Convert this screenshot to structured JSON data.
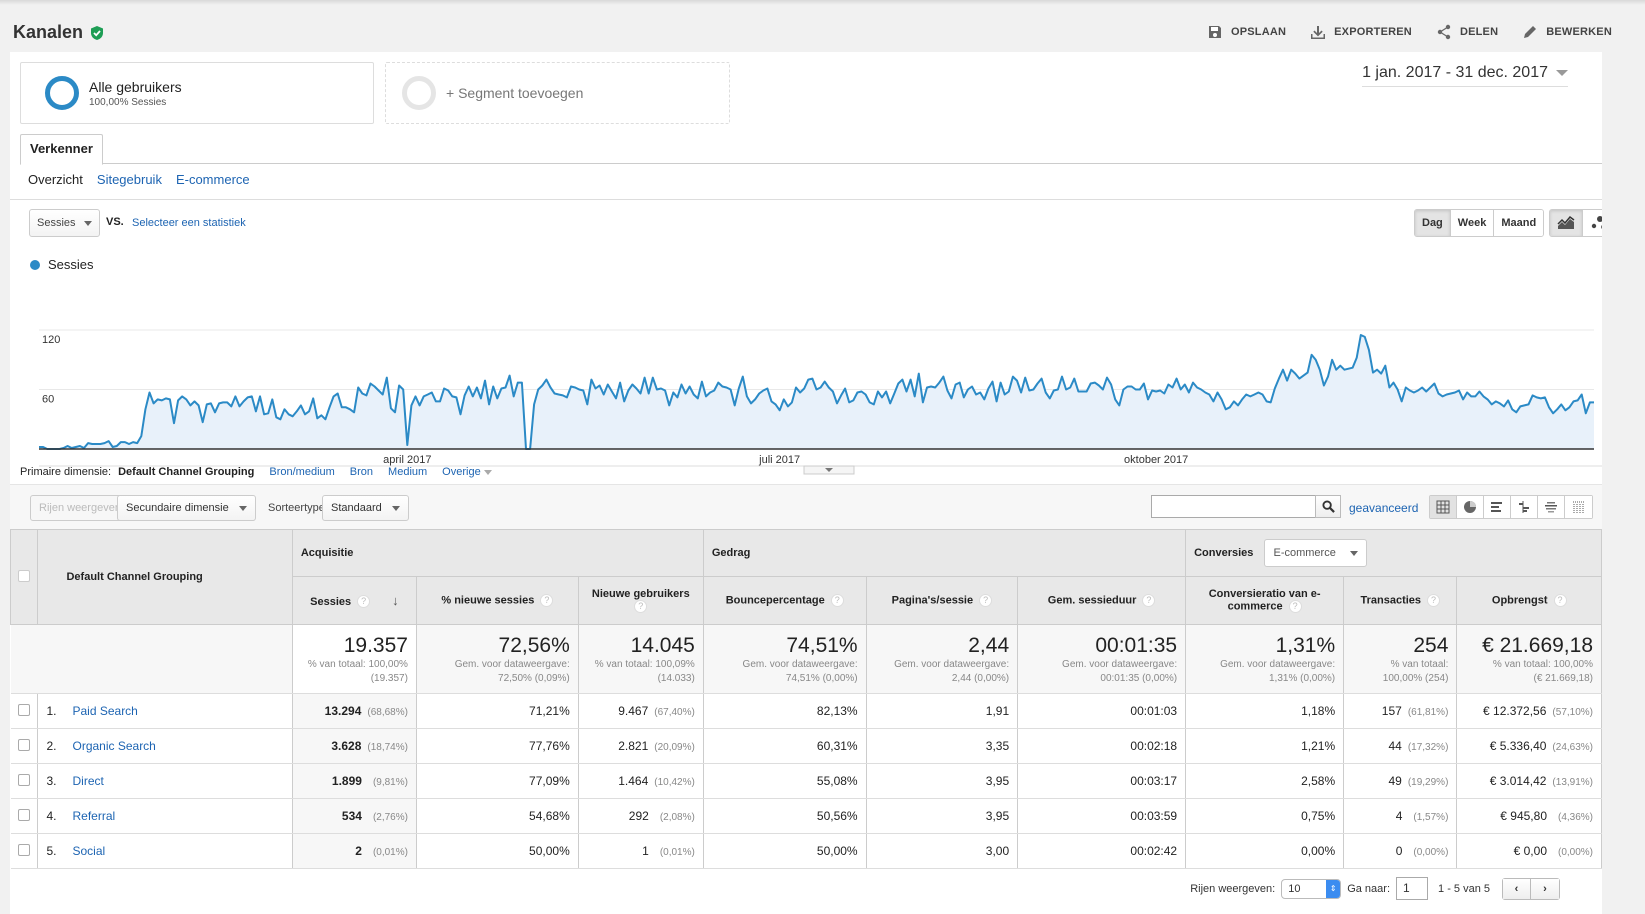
{
  "header": {
    "title": "Kanalen",
    "verified_icon": "shield-check-icon",
    "actions": [
      {
        "label": "OPSLAAN",
        "icon": "save-icon"
      },
      {
        "label": "EXPORTEREN",
        "icon": "download-icon"
      },
      {
        "label": "DELEN",
        "icon": "share-icon"
      },
      {
        "label": "BEWERKEN",
        "icon": "pencil-icon"
      }
    ]
  },
  "segments": {
    "active": {
      "name": "Alle gebruikers",
      "sub": "100,00% Sessies"
    },
    "add_label": "+ Segment toevoegen"
  },
  "date_range": "1 jan. 2017 - 31 dec. 2017",
  "tabs": {
    "main": "Verkenner",
    "sub": [
      {
        "label": "Overzicht",
        "selected": true
      },
      {
        "label": "Sitegebruik",
        "selected": false
      },
      {
        "label": "E-commerce",
        "selected": false
      }
    ]
  },
  "chart_controls": {
    "metric": "Sessies",
    "vs_label": "VS.",
    "compare_link": "Selecteer een statistiek",
    "periods": [
      {
        "label": "Dag",
        "active": true
      },
      {
        "label": "Week",
        "active": false
      },
      {
        "label": "Maand",
        "active": false
      }
    ],
    "chart_types": [
      {
        "icon": "line-chart-icon",
        "active": true
      },
      {
        "icon": "motion-chart-icon",
        "active": false
      }
    ]
  },
  "chart_data": {
    "type": "area",
    "title": "",
    "legend": [
      "Sessies"
    ],
    "legend_position": "top-left",
    "color": "#2b8ac6",
    "fill": "#e8f1fa",
    "xlabel": "",
    "ylabel": "",
    "ylim": [
      0,
      120
    ],
    "yticks": [
      60,
      120
    ],
    "x_range": [
      "2017-01-01",
      "2017-12-31"
    ],
    "xticks": [
      {
        "label": "april 2017",
        "day": 90
      },
      {
        "label": "juli 2017",
        "day": 181
      },
      {
        "label": "oktober 2017",
        "day": 273
      }
    ],
    "grid": true,
    "series": [
      {
        "name": "Sessies",
        "values": [
          2,
          2,
          0,
          0,
          0,
          0,
          1,
          3,
          1,
          2,
          3,
          1,
          6,
          5,
          5,
          5,
          6,
          8,
          2,
          3,
          7,
          7,
          5,
          7,
          6,
          13,
          40,
          57,
          46,
          50,
          49,
          51,
          50,
          26,
          49,
          53,
          50,
          44,
          48,
          44,
          27,
          45,
          46,
          37,
          46,
          47,
          47,
          43,
          53,
          43,
          48,
          52,
          53,
          38,
          53,
          35,
          36,
          50,
          32,
          30,
          40,
          35,
          33,
          38,
          44,
          35,
          38,
          51,
          31,
          34,
          30,
          42,
          53,
          56,
          42,
          42,
          40,
          37,
          62,
          56,
          54,
          66,
          63,
          59,
          55,
          72,
          41,
          37,
          64,
          60,
          4,
          44,
          53,
          44,
          53,
          55,
          57,
          48,
          48,
          61,
          59,
          53,
          52,
          35,
          54,
          63,
          53,
          62,
          51,
          69,
          45,
          63,
          51,
          61,
          62,
          74,
          53,
          67,
          67,
          0,
          0,
          45,
          60,
          64,
          70,
          62,
          56,
          55,
          54,
          52,
          63,
          62,
          60,
          59,
          45,
          70,
          61,
          64,
          55,
          65,
          58,
          51,
          67,
          48,
          59,
          65,
          61,
          56,
          72,
          56,
          72,
          60,
          61,
          59,
          44,
          57,
          52,
          65,
          56,
          63,
          55,
          51,
          68,
          53,
          57,
          59,
          67,
          63,
          62,
          60,
          44,
          61,
          73,
          53,
          46,
          50,
          56,
          59,
          61,
          48,
          45,
          39,
          50,
          43,
          47,
          62,
          57,
          61,
          70,
          71,
          60,
          62,
          68,
          62,
          58,
          46,
          54,
          61,
          47,
          49,
          57,
          58,
          55,
          47,
          45,
          58,
          52,
          58,
          46,
          56,
          66,
          70,
          58,
          70,
          53,
          76,
          47,
          62,
          63,
          62,
          67,
          73,
          59,
          51,
          65,
          67,
          52,
          60,
          63,
          55,
          57,
          50,
          61,
          68,
          48,
          67,
          55,
          58,
          73,
          69,
          57,
          72,
          59,
          60,
          66,
          71,
          57,
          51,
          59,
          60,
          73,
          60,
          62,
          71,
          58,
          58,
          58,
          66,
          67,
          64,
          60,
          72,
          65,
          50,
          44,
          60,
          63,
          63,
          60,
          60,
          66,
          50,
          59,
          58,
          59,
          56,
          65,
          62,
          71,
          60,
          65,
          57,
          67,
          62,
          60,
          57,
          55,
          48,
          57,
          50,
          40,
          42,
          48,
          44,
          50,
          55,
          53,
          55,
          57,
          55,
          48,
          47,
          61,
          71,
          80,
          69,
          80,
          76,
          71,
          74,
          77,
          95,
          90,
          80,
          64,
          73,
          90,
          80,
          84,
          80,
          81,
          82,
          92,
          115,
          113,
          100,
          77,
          80,
          76,
          84,
          62,
          67,
          60,
          48,
          62,
          59,
          57,
          59,
          62,
          58,
          62,
          66,
          56,
          53,
          55,
          56,
          57,
          59,
          50,
          57,
          53,
          53,
          58,
          53,
          50,
          45,
          48,
          46,
          43,
          49,
          40,
          37,
          43,
          44,
          45,
          54,
          52,
          51,
          52,
          42,
          36,
          40,
          45,
          39,
          42,
          48,
          49,
          55,
          36,
          47,
          47
        ]
      }
    ]
  },
  "dimensions": {
    "label": "Primaire dimensie:",
    "selected": "Default Channel Grouping",
    "options": [
      "Bron/medium",
      "Bron",
      "Medium",
      "Overige"
    ]
  },
  "table_toolbar": {
    "plot_rows": "Rijen weergeven",
    "secondary_dim": "Secundaire dimensie",
    "sort_label": "Sorteertype:",
    "sort_value": "Standaard",
    "search_value": "",
    "advanced": "geavanceerd",
    "views": [
      "table-view-icon",
      "pie-view-icon",
      "bar-view-icon",
      "comparison-view-icon",
      "term-cloud-view-icon",
      "pivot-view-icon"
    ]
  },
  "table": {
    "dim_header": "Default Channel Grouping",
    "groups": {
      "acquisition": "Acquisitie",
      "behavior": "Gedrag",
      "conversions": "Conversies",
      "conversion_select": "E-commerce"
    },
    "columns": [
      "Sessies",
      "% nieuwe sessies",
      "Nieuwe gebruikers",
      "Bouncepercentage",
      "Pagina's/sessie",
      "Gem. sessieduur",
      "Conversieratio van e-commerce",
      "Transacties",
      "Opbrengst"
    ],
    "totals": [
      {
        "value": "19.357",
        "sub1": "% van totaal: 100,00%",
        "sub2": "(19.357)"
      },
      {
        "value": "72,56%",
        "sub1": "Gem. voor dataweergave:",
        "sub2": "72,50% (0,09%)"
      },
      {
        "value": "14.045",
        "sub1": "% van totaal: 100,09%",
        "sub2": "(14.033)"
      },
      {
        "value": "74,51%",
        "sub1": "Gem. voor dataweergave:",
        "sub2": "74,51% (0,00%)"
      },
      {
        "value": "2,44",
        "sub1": "Gem. voor dataweergave:",
        "sub2": "2,44 (0,00%)"
      },
      {
        "value": "00:01:35",
        "sub1": "Gem. voor dataweergave:",
        "sub2": "00:01:35 (0,00%)"
      },
      {
        "value": "1,31%",
        "sub1": "Gem. voor dataweergave:",
        "sub2": "1,31% (0,00%)"
      },
      {
        "value": "254",
        "sub1": "% van totaal:",
        "sub2": "100,00% (254)"
      },
      {
        "value": "€ 21.669,18",
        "sub1": "% van totaal: 100,00%",
        "sub2": "(€ 21.669,18)"
      }
    ],
    "rows": [
      {
        "num": "1.",
        "channel": "Paid Search",
        "sessions": "13.294",
        "sessions_pct": "(68,68%)",
        "new_sessions": "71,21%",
        "new_users": "9.467",
        "new_users_pct": "(67,40%)",
        "bounce": "82,13%",
        "pages": "1,91",
        "duration": "00:01:03",
        "conv": "1,18%",
        "transactions": "157",
        "transactions_pct": "(61,81%)",
        "revenue": "€ 12.372,56",
        "revenue_pct": "(57,10%)"
      },
      {
        "num": "2.",
        "channel": "Organic Search",
        "sessions": "3.628",
        "sessions_pct": "(18,74%)",
        "new_sessions": "77,76%",
        "new_users": "2.821",
        "new_users_pct": "(20,09%)",
        "bounce": "60,31%",
        "pages": "3,35",
        "duration": "00:02:18",
        "conv": "1,21%",
        "transactions": "44",
        "transactions_pct": "(17,32%)",
        "revenue": "€ 5.336,40",
        "revenue_pct": "(24,63%)"
      },
      {
        "num": "3.",
        "channel": "Direct",
        "sessions": "1.899",
        "sessions_pct": "(9,81%)",
        "new_sessions": "77,09%",
        "new_users": "1.464",
        "new_users_pct": "(10,42%)",
        "bounce": "55,08%",
        "pages": "3,95",
        "duration": "00:03:17",
        "conv": "2,58%",
        "transactions": "49",
        "transactions_pct": "(19,29%)",
        "revenue": "€ 3.014,42",
        "revenue_pct": "(13,91%)"
      },
      {
        "num": "4.",
        "channel": "Referral",
        "sessions": "534",
        "sessions_pct": "(2,76%)",
        "new_sessions": "54,68%",
        "new_users": "292",
        "new_users_pct": "(2,08%)",
        "bounce": "50,56%",
        "pages": "3,95",
        "duration": "00:03:59",
        "conv": "0,75%",
        "transactions": "4",
        "transactions_pct": "(1,57%)",
        "revenue": "€ 945,80",
        "revenue_pct": "(4,36%)"
      },
      {
        "num": "5.",
        "channel": "Social",
        "sessions": "2",
        "sessions_pct": "(0,01%)",
        "new_sessions": "50,00%",
        "new_users": "1",
        "new_users_pct": "(0,01%)",
        "bounce": "50,00%",
        "pages": "3,00",
        "duration": "00:02:42",
        "conv": "0,00%",
        "transactions": "0",
        "transactions_pct": "(0,00%)",
        "revenue": "€ 0,00",
        "revenue_pct": "(0,00%)"
      }
    ]
  },
  "pagination": {
    "rows_label": "Rijen weergeven:",
    "rows_value": "10",
    "goto_label": "Ga naar:",
    "goto_value": "1",
    "range": "1 - 5 van 5",
    "prev": "‹",
    "next": "›"
  }
}
